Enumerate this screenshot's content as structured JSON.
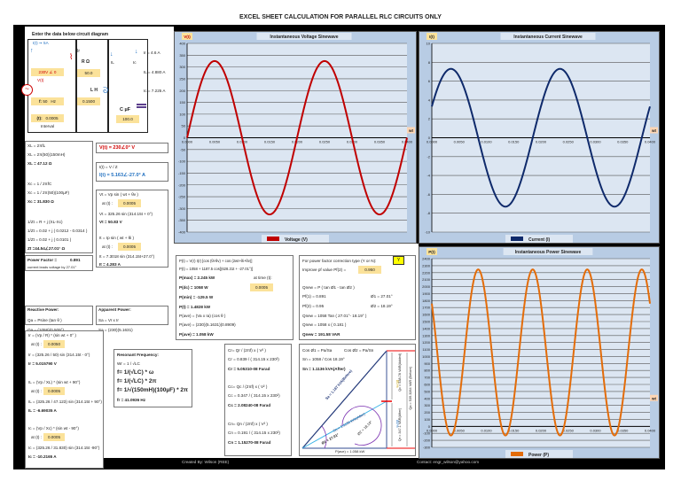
{
  "title": "EXCEL SHEET CALCULATION FOR PARALLEL RLC CIRCUITS ONLY",
  "circuit": {
    "heading": "Enter the data below circuit diagram",
    "it": "I(t)",
    "it_val": "5A",
    "v_label": "V(t)",
    "voltage": "230V",
    "angle": "0",
    "r_label": "R Ω",
    "r_val": "50.0",
    "l_label": "L H",
    "l_val": "0.1500",
    "c_label": "C µF",
    "c_val": "100.0",
    "f_label": "f:",
    "f_val": "50",
    "f_unit": "Hz",
    "t_label": "(t):",
    "t_val": "0.0005",
    "interval": "Interval",
    "ir_branch": "Ir",
    "il_branch": "IL",
    "ic_branch": "Ic",
    "ir": "Ir = 4.6 A",
    "il": "IL = 4.880 A",
    "ic": "Ic = 7.225 A"
  },
  "impedance": {
    "lines": [
      "XL = 2πfL",
      "XL = 2π(50)(150mH)",
      "XL = 47.12 Ω",
      "Xc = 1 / 2πfC",
      "Xc = 1 / 2π(50)(100µF)",
      "Xc = 31.830 Ω",
      "1/Zt = R + j (XL-Xc)",
      "1/Zt = 0.02 + j ( 0.0212 - 0.0314 )",
      "1/Zt = 0.02 + j ( 0.0101 )",
      "Zt =44.54∠27.01° Ω"
    ]
  },
  "vt_box": "V(t) = 230∠0° V",
  "it_box": {
    "l1": "I(t) = V / Z",
    "l2": "I(t) = 5.163∠-27.0° A"
  },
  "inst": {
    "l1": "Vt = Vp sin ( wt + θv )",
    "at1": "at (t) :",
    "t1": "0.0005",
    "l2": "Vt = 325.26 sin (314.15t + 0°)",
    "l3": "Vt = 50.83 V",
    "l4": "It = Ip sin ( wt + θi )",
    "at2": "at (t) :",
    "t2": "0.0005",
    "l5": "It = 7.3018 sin (314.15t+27.0°)",
    "l6": "It = 4.283 A"
  },
  "pf": {
    "label": "Power Factor =",
    "value": "0.891",
    "note": "current leads voltage by 27.01°"
  },
  "reactive": {
    "title": "Reactive Power:",
    "l1": "Qa = Psine (tan θ )",
    "l2": "Qa = (1058)(0.509°)",
    "l3": "Qa = 539.3286 VAR"
  },
  "apparent": {
    "title": "Apparent Power:",
    "l1": "Sa = Vr x Ir",
    "l2": "Sa = (230)(5.1631)",
    "l3": "Sa = 1.187 kVA"
  },
  "power": {
    "l1": "P(t) = V(r) I(r) [cos (θi-θv) + cos (2wt+θi+θv)]",
    "l2": "P(t) = 1058 + 1187.5 cos[(628.31t + -27.01°)]",
    "l3": "P(max) = 2.245 kW",
    "at": "at time (t):",
    "t": "0.0005",
    "l4": "P(dc) = 1058 W",
    "l5": "P(min) = -129.5 W",
    "l6": "P(t) = 1.4828 kW",
    "l7": "P(ave) = (Va x Ia) (cos θ )",
    "l8": "P(ave) = (230)(5.1631)(0.8909)",
    "l9": "P(ave) = 1.058 kW"
  },
  "correction": {
    "type_label": "For power factor correction type (Y or N):",
    "type_val": "Y",
    "improve_label": "Improve pf value Pf(2) =",
    "improve_val": "0.950",
    "l1": "Qnew = P ( tan Ø1 - tan Ø2 )",
    "l2": "Pf(1) = 0.891",
    "l2b": "Ø1 = 27.01°",
    "l3": "Pf(2) = 0.95",
    "l3b": "Ø2 = 18.19°",
    "l4": "Qnew = 1058 Tan ( 27.01°- 18.19° )",
    "l5": "Qnew = 1058 x ( 0.181 )",
    "l6": "Qnew = 191.58 VAR"
  },
  "branches": {
    "l1": "Ir = (Vp / R) * (sin wt + 0° )",
    "at1": "at (t) :",
    "t1": "0.0050",
    "l2": "Ir = (325.26 / 50) sin (314.15t - 0°)",
    "l3": "Ir = 5.015790 V",
    "l4": "IL = (Vp / XL) * (sin wt + 90°)",
    "at2": "at (t) :",
    "t2": "0.0005",
    "l5": "IL = (325.26 / 47.123) sin (314.15t + 90°)",
    "l6": "IL = -6.69035 A",
    "l7": "Ic = (Vp / Xc) * (sin wt - 90°)",
    "at3": "at (t) :",
    "t3": "0.0005",
    "l8": "Ic = (325.26 / 31.830) sin (314.15t -90°)",
    "l9": "Ic = -10.2165 A"
  },
  "resonant": {
    "title": "Resonant Frequency:",
    "l1": "Wr = 1 / √LC",
    "l2": "f= 1/(√LC) * ω",
    "l3": "f= 1/(√LC) * 2π",
    "l4": "f= 1/√(150mH)(100µF) * 2π",
    "l5": "fr = 41.0936 Hz"
  },
  "capacitance": {
    "l1": "Cr= Qr / (2πf) x ( V² )",
    "l2": "Cr = 0.839 / ( 314.15 x 230²)",
    "l3": "Cr = 5.05310-08 Farad",
    "l4": "Cc= Qc / (2πf) x ( V² )",
    "l5": "Cc = 0.347 / ( 314.15 x 230²)",
    "l6": "Cc = 2.08240-08 Farad",
    "l7": "Cn= Qn / (2πf) x ( V² )",
    "l8": "Cn = 0.191 / ( 314.15 x 230²)",
    "l9": "Cn = 1.15270-08 Farad"
  },
  "triangle": {
    "l1": "Cos Ø1 = Pa/Sa",
    "l1b": "Cos Ø2 = Pa/Sn",
    "l2": "Sn = 1058 / Cos 18.19°",
    "l3": "Sn = 1.1136 kVA(After)",
    "sa": "Sa = 1.187 kVA(Before)",
    "sn": "Sn = 1.1136 kVA(After)",
    "phi1": "Ø1 = 27.01°",
    "phi2": "Ø2 = 18.19°",
    "pave": "P(ave) = 1.058 kW",
    "qc": "Qc = 538.78 VAR(Added)",
    "qr": "Qr = 347.1 VAR(After)",
    "qa": "Qa = 539.3284 VAR (Before)",
    "d1": "Ø1%",
    "d2": "Ø2%"
  },
  "footer": {
    "created": "Created By: Wilson (REE)",
    "contact": "Contact: engr_wilson@yahoo.com"
  },
  "colors": {
    "voltage": "#c00000",
    "current": "#0f2a6b",
    "power": "#e36c09",
    "plot_bg": "#dce6f2",
    "chart_bg": "#b8cce4",
    "input": "#fbe29a"
  },
  "chart_data": [
    {
      "type": "line",
      "title": "Instantaneous Voltage Sinewave",
      "ylabel": "V(t)",
      "xlabel": "wt",
      "legend": "Voltage (V)",
      "legend_position": "bottom",
      "xlim": [
        0,
        0.04
      ],
      "xticks": [
        0,
        0.005,
        0.01,
        0.015,
        0.02,
        0.025,
        0.03,
        0.035,
        0.04
      ],
      "ylim": [
        -400,
        400
      ],
      "ystep": 50,
      "series": {
        "name": "Voltage (V)",
        "function": "offset + amplitude*sin(omega*t + phase_deg)",
        "amplitude": 325.26,
        "omega": 314.15,
        "phase_deg": 0,
        "offset": 0
      }
    },
    {
      "type": "line",
      "title": "Instantaneous Current Sinewave",
      "ylabel": "I(t)",
      "xlabel": "wt",
      "legend": "Current (I)",
      "legend_position": "bottom",
      "xlim": [
        0,
        0.04
      ],
      "xticks": [
        0,
        0.005,
        0.01,
        0.015,
        0.02,
        0.025,
        0.03,
        0.035,
        0.04
      ],
      "ylim": [
        -10,
        10
      ],
      "ystep": 2,
      "series": {
        "name": "Current (I)",
        "function": "offset + amplitude*sin(omega*t + phase_deg)",
        "amplitude": 7.3018,
        "omega": 314.15,
        "phase_deg": 27.01,
        "offset": 0
      }
    },
    {
      "type": "line",
      "title": "Instantaneous Power Sinewave",
      "ylabel": "P(t)",
      "xlabel": "wt",
      "legend": "Power (P)",
      "legend_position": "bottom",
      "xlim": [
        0,
        0.04
      ],
      "xticks": [
        0,
        0.005,
        0.01,
        0.015,
        0.02,
        0.025,
        0.03,
        0.035,
        0.04
      ],
      "ylim": [
        -300,
        2400
      ],
      "ystep": 100,
      "series": {
        "name": "Power (P)",
        "function": "offset + amplitude*cos(omega*t + phase_deg)",
        "amplitude": 1187.5,
        "omega": 628.31,
        "phase_deg": 54,
        "offset": 1058
      }
    }
  ]
}
